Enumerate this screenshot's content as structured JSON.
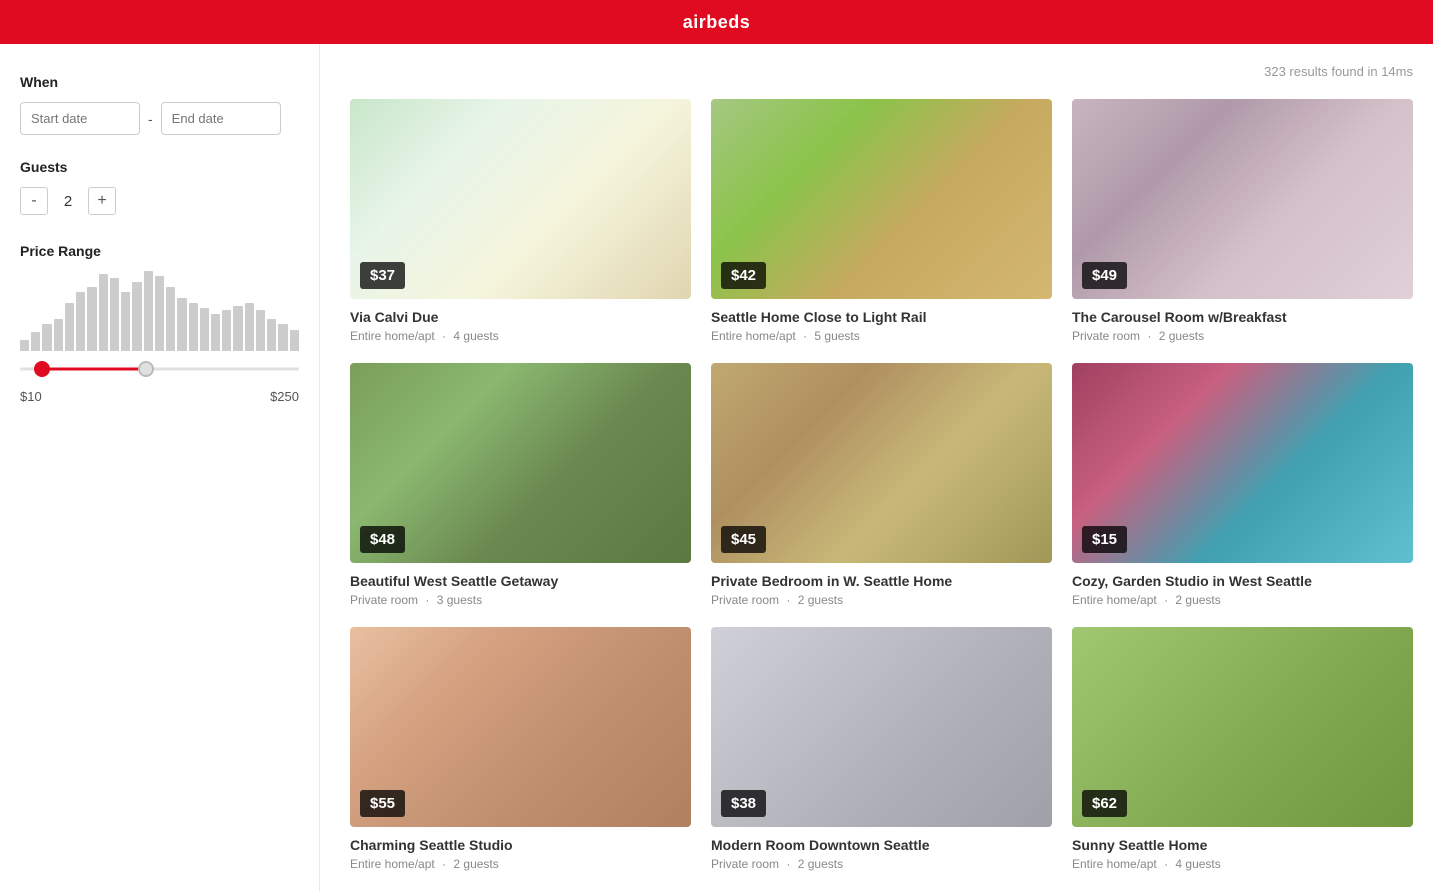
{
  "header": {
    "title": "airbeds"
  },
  "sidebar": {
    "when_label": "When",
    "start_date_placeholder": "Start date",
    "end_date_placeholder": "End date",
    "guests_label": "Guests",
    "guests_count": "2",
    "guests_decrement": "-",
    "guests_increment": "+",
    "price_range_label": "Price Range",
    "price_min": "$10",
    "price_max": "$250",
    "histogram_bars": [
      10,
      18,
      25,
      30,
      45,
      55,
      60,
      72,
      68,
      55,
      65,
      75,
      70,
      60,
      50,
      45,
      40,
      35,
      38,
      42,
      45,
      38,
      30,
      25,
      20
    ]
  },
  "main": {
    "results_text": "323 results found in 14ms",
    "listings": [
      {
        "id": 1,
        "title": "Via Calvi Due",
        "type": "Entire home/apt",
        "guests": "4 guests",
        "price": "$37",
        "img_class": "img-1"
      },
      {
        "id": 2,
        "title": "Seattle Home Close to Light Rail",
        "type": "Entire home/apt",
        "guests": "5 guests",
        "price": "$42",
        "img_class": "img-2"
      },
      {
        "id": 3,
        "title": "The Carousel Room w/Breakfast",
        "type": "Private room",
        "guests": "2 guests",
        "price": "$49",
        "img_class": "img-3"
      },
      {
        "id": 4,
        "title": "Beautiful West Seattle Getaway",
        "type": "Private room",
        "guests": "3 guests",
        "price": "$48",
        "img_class": "img-4"
      },
      {
        "id": 5,
        "title": "Private Bedroom in W. Seattle Home",
        "type": "Private room",
        "guests": "2 guests",
        "price": "$45",
        "img_class": "img-5"
      },
      {
        "id": 6,
        "title": "Cozy, Garden Studio in West Seattle",
        "type": "Entire home/apt",
        "guests": "2 guests",
        "price": "$15",
        "img_class": "img-6"
      },
      {
        "id": 7,
        "title": "Charming Seattle Studio",
        "type": "Entire home/apt",
        "guests": "2 guests",
        "price": "$55",
        "img_class": "img-7"
      },
      {
        "id": 8,
        "title": "Modern Room Downtown Seattle",
        "type": "Private room",
        "guests": "2 guests",
        "price": "$38",
        "img_class": "img-8"
      },
      {
        "id": 9,
        "title": "Sunny Seattle Home",
        "type": "Entire home/apt",
        "guests": "4 guests",
        "price": "$62",
        "img_class": "img-9"
      }
    ]
  }
}
